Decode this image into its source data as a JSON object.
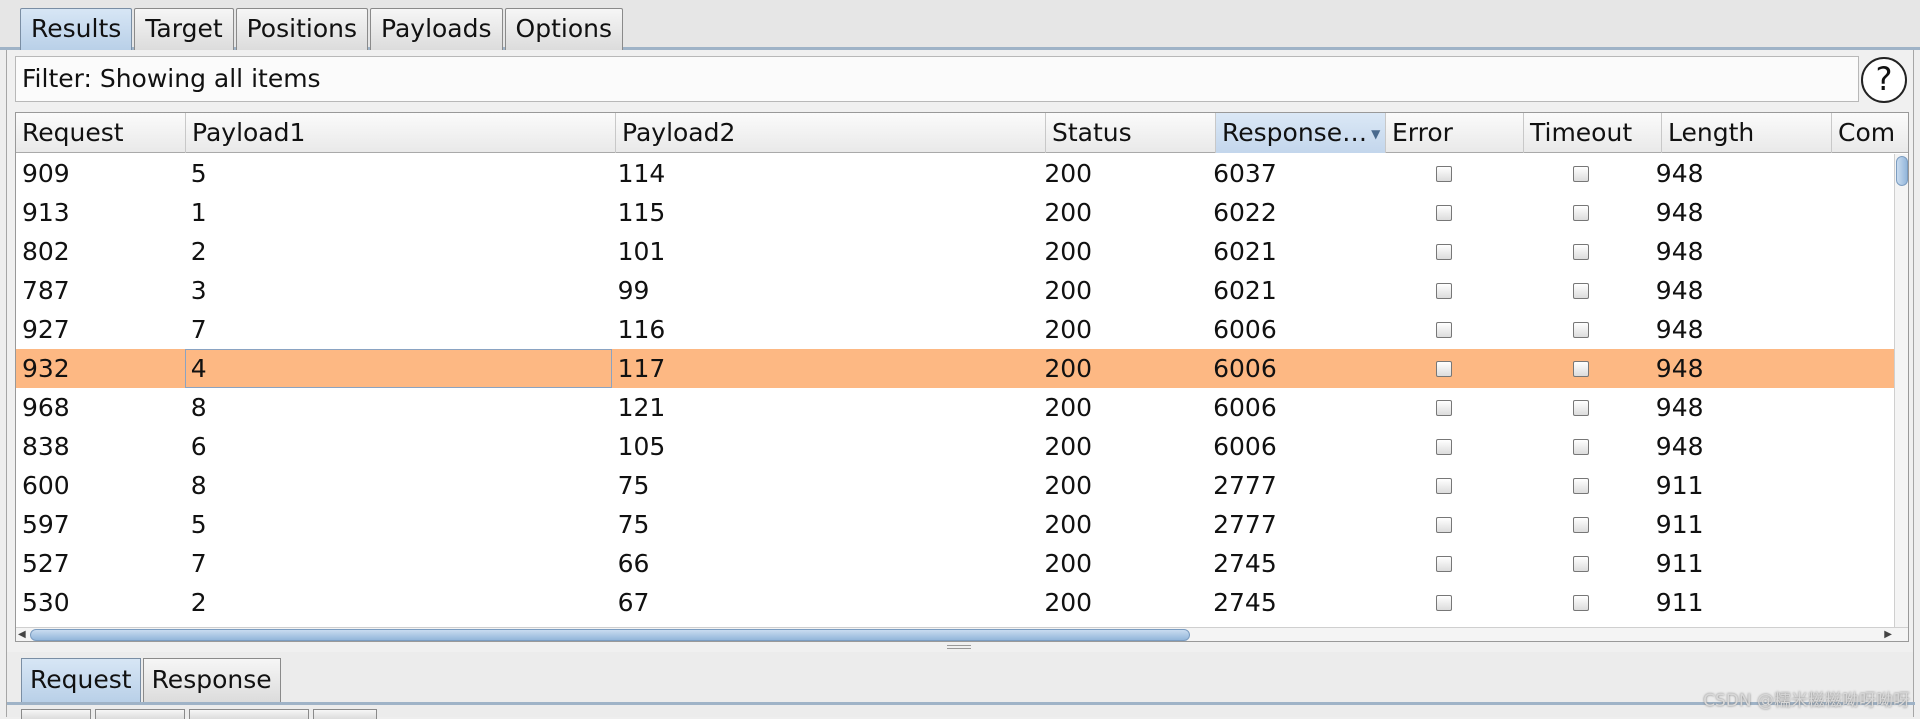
{
  "top_tabs": [
    "Results",
    "Target",
    "Positions",
    "Payloads",
    "Options"
  ],
  "active_top_tab": "Results",
  "filter": {
    "text": "Filter: Showing all items",
    "help_label": "?"
  },
  "table": {
    "columns": [
      "Request",
      "Payload1",
      "Payload2",
      "Status",
      "Response…",
      "Error",
      "Timeout",
      "Length",
      "Com"
    ],
    "sorted_column": "Response…",
    "rows": [
      [
        "909",
        "5",
        "114",
        "200",
        "6037",
        false,
        false,
        "948"
      ],
      [
        "913",
        "1",
        "115",
        "200",
        "6022",
        false,
        false,
        "948"
      ],
      [
        "802",
        "2",
        "101",
        "200",
        "6021",
        false,
        false,
        "948"
      ],
      [
        "787",
        "3",
        "99",
        "200",
        "6021",
        false,
        false,
        "948"
      ],
      [
        "927",
        "7",
        "116",
        "200",
        "6006",
        false,
        false,
        "948"
      ],
      [
        "932",
        "4",
        "117",
        "200",
        "6006",
        false,
        false,
        "948"
      ],
      [
        "968",
        "8",
        "121",
        "200",
        "6006",
        false,
        false,
        "948"
      ],
      [
        "838",
        "6",
        "105",
        "200",
        "6006",
        false,
        false,
        "948"
      ],
      [
        "600",
        "8",
        "75",
        "200",
        "2777",
        false,
        false,
        "911"
      ],
      [
        "597",
        "5",
        "75",
        "200",
        "2777",
        false,
        false,
        "911"
      ],
      [
        "527",
        "7",
        "66",
        "200",
        "2745",
        false,
        false,
        "911"
      ],
      [
        "530",
        "2",
        "67",
        "200",
        "2745",
        false,
        false,
        "911"
      ]
    ],
    "selected_row": "932",
    "selected_color": "#fdb883"
  },
  "bottom_tabs": [
    "Request",
    "Response"
  ],
  "active_bottom_tab": "Request",
  "watermark": "CSDN @糯米糍糍呦呀呦呀"
}
